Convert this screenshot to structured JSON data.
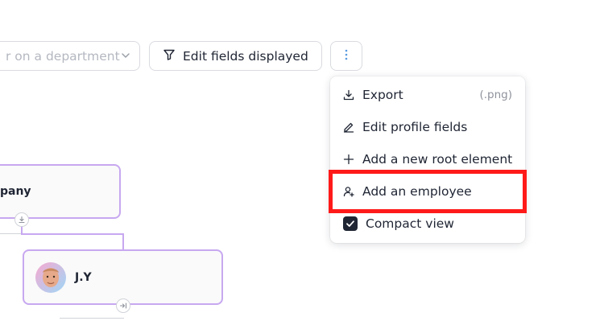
{
  "toolbar": {
    "department_filter_placeholder": "r on a department",
    "edit_fields_label": "Edit fields displayed"
  },
  "menu": {
    "items": [
      {
        "label": "Export",
        "shortcut": "(.png)",
        "icon": "download-icon"
      },
      {
        "label": "Edit profile fields",
        "icon": "pencil-icon"
      },
      {
        "label": "Add a new root element",
        "icon": "plus-icon"
      },
      {
        "label": "Add an employee",
        "icon": "add-person-icon"
      },
      {
        "label": "Compact view",
        "icon": "checkbox-checked-icon",
        "checked": true
      }
    ]
  },
  "org_chart": {
    "root_card_title": "pany",
    "employee_name": "J.Y"
  },
  "colors": {
    "accent_border": "#c7a8f0",
    "highlight": "#ff1a1a",
    "text": "#1f2533"
  }
}
